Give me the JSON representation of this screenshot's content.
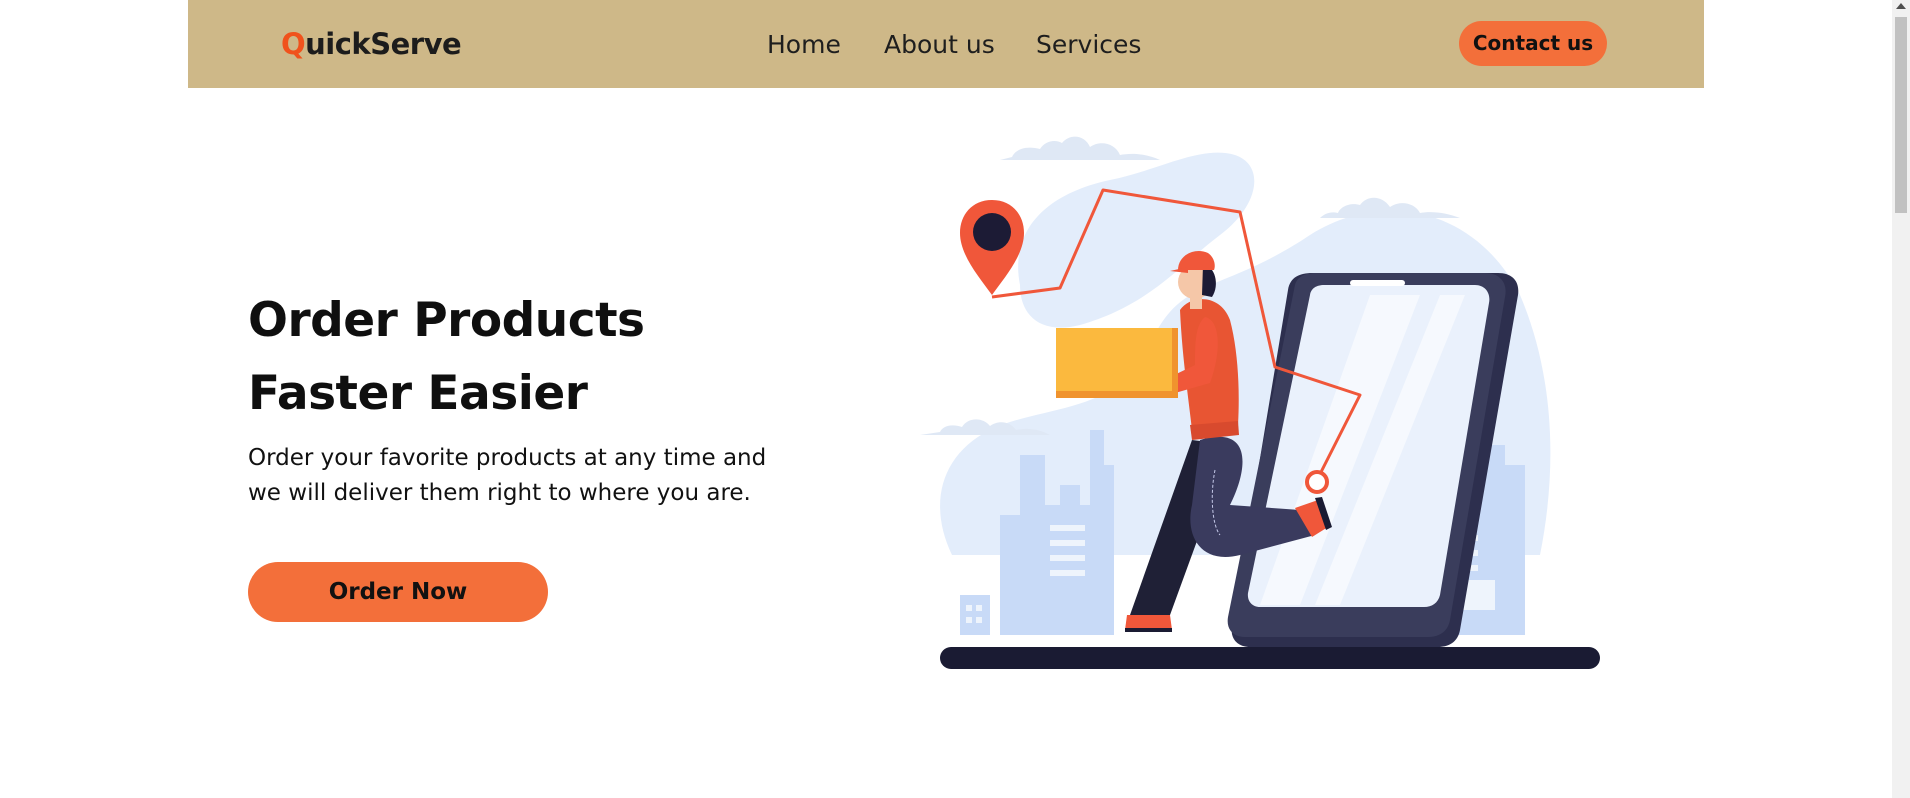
{
  "brand": {
    "first_letter": "Q",
    "rest": "uickServe"
  },
  "nav": {
    "items": [
      {
        "label": "Home"
      },
      {
        "label": "About us"
      },
      {
        "label": "Services"
      }
    ],
    "contact_label": "Contact us"
  },
  "hero": {
    "title_line1": "Order Products",
    "title_line2": "Faster Easier",
    "description": "Order your favorite products at any time and we will deliver them right to where you are.",
    "cta_label": "Order Now"
  },
  "illustration": {
    "subject": "delivery person carrying a box out of a smartphone screen",
    "icons": [
      "location-pin-icon",
      "route-line",
      "package-box",
      "smartphone",
      "city-skyline",
      "clouds"
    ]
  },
  "colors": {
    "navbar_bg": "#ceb888",
    "accent": "#f36f3a",
    "logo_accent": "#f0521c",
    "blob": "#e3edfb",
    "city": "#c8daf7",
    "phone_body": "#3a3d5c",
    "ground": "#1a1b33",
    "box": "#fbb93e"
  }
}
